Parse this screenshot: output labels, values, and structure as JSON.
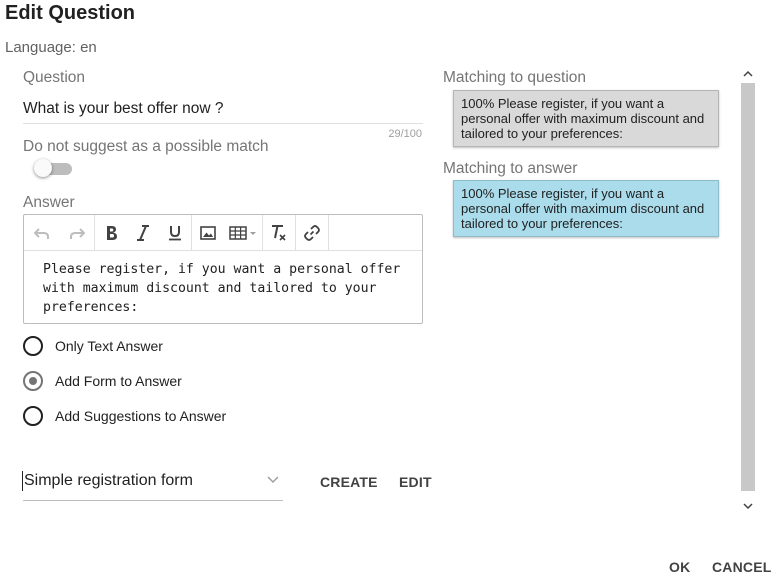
{
  "dialog": {
    "title": "Edit Question",
    "language": "Language: en"
  },
  "question": {
    "label": "Question",
    "value": "What is your best offer now ?",
    "counter": "29/100"
  },
  "suggest_toggle": {
    "label": "Do not suggest as a possible match",
    "on": false
  },
  "answer": {
    "label": "Answer",
    "toolbar_icons": [
      "undo-icon",
      "redo-icon",
      "bold-icon",
      "italic-icon",
      "underline-icon",
      "image-icon",
      "table-icon",
      "clear-format-icon",
      "link-icon"
    ],
    "text": "Please register, if you want a personal offer with maximum discount and tailored to your preferences:"
  },
  "answer_type": {
    "options": [
      "Only Text Answer",
      "Add Form to Answer",
      "Add Suggestions to Answer"
    ],
    "selected": "Add Form to Answer"
  },
  "form_select": {
    "value": "Simple registration form",
    "create_label": "CREATE",
    "edit_label": "EDIT"
  },
  "matching_question": {
    "label": "Matching to question",
    "text": "100% Please register, if you want a personal offer with maximum discount and tailored to your preferences:",
    "color": "#d9d9d9"
  },
  "matching_answer": {
    "label": "Matching to answer",
    "text": "100% Please register, if you want a personal offer with maximum discount and tailored to your preferences:",
    "color": "#aadceb"
  },
  "actions": {
    "ok_label": "OK",
    "cancel_label": "CANCEL"
  }
}
